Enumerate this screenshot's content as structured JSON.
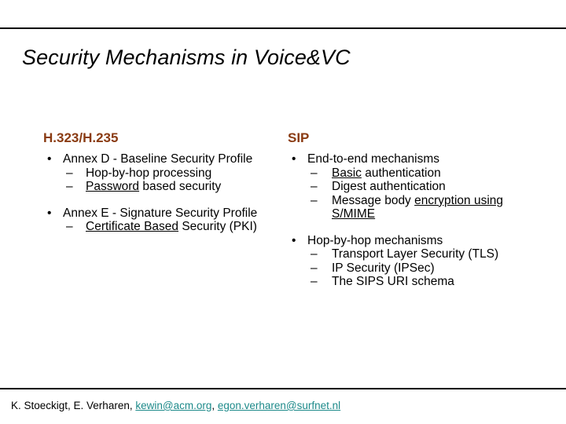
{
  "slide": {
    "title": "Security Mechanisms in Voice&VC",
    "accent_color": "#8a3b12",
    "link_color": "#1d8a8a",
    "text_color": "#000000",
    "background_color": "#ffffff"
  },
  "columns": {
    "left": {
      "heading": "H.323/H.235",
      "bullets": [
        {
          "marker": "•",
          "text": "Annex D - Baseline Security Profile",
          "sub": [
            {
              "marker": "–",
              "text": "Hop-by-hop processing",
              "underline": ""
            },
            {
              "marker": "–",
              "text": "Password based security",
              "underline": "Password"
            }
          ]
        },
        {
          "marker": "•",
          "text": "Annex E - Signature Security Profile",
          "sub": [
            {
              "marker": "–",
              "text": "Certificate Based Security (PKI)",
              "underline": "Certificate Based"
            }
          ]
        }
      ]
    },
    "right": {
      "heading": "SIP",
      "bullets": [
        {
          "marker": "•",
          "text": "End-to-end mechanisms",
          "sub": [
            {
              "marker": "–",
              "text": "Basic authentication",
              "underline": "Basic"
            },
            {
              "marker": "–",
              "text": "Digest authentication",
              "underline": ""
            },
            {
              "marker": "–",
              "text": "Message body encryption using S/MIME",
              "underline": "encryption using S/MIME"
            }
          ]
        },
        {
          "marker": "•",
          "text": "Hop-by-hop mechanisms",
          "sub": [
            {
              "marker": "–",
              "text": "Transport Layer Security (TLS)",
              "underline": ""
            },
            {
              "marker": "–",
              "text": "IP Security (IPSec)",
              "underline": ""
            },
            {
              "marker": "–",
              "text": "The SIPS URI schema",
              "underline": ""
            }
          ]
        }
      ]
    }
  },
  "footer": {
    "authors": "K. Stoeckigt, E. Verharen, ",
    "email1": "kewin@acm.org",
    "separator": ", ",
    "email2": "egon.verharen@surfnet.nl"
  }
}
